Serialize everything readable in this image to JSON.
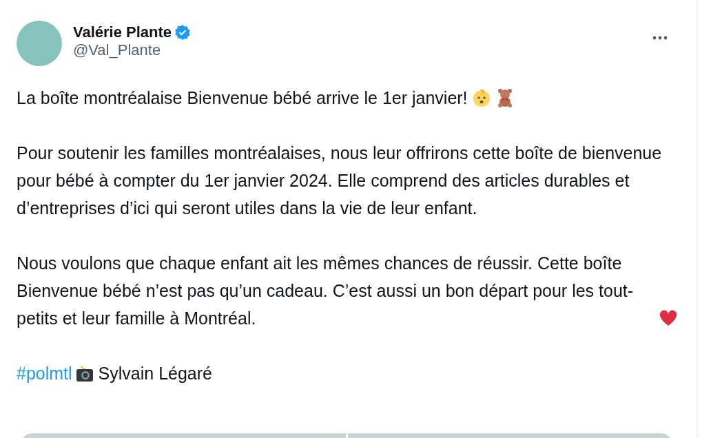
{
  "author": {
    "name": "Valérie Plante",
    "verified": true,
    "handle": "@Val_Plante"
  },
  "paragraphs": [
    "La boîte montréalaise Bienvenue bébé arrive le 1er janvier!",
    "Pour soutenir les familles montréalaises, nous leur offrirons cette boîte de bienvenue pour bébé à compter du 1er janvier 2024. Elle comprend des articles durables et d’entreprises d’ici qui seront utiles dans la vie de leur enfant.",
    "Nous voulons que chaque enfant ait les mêmes chances de réussir. Cette boîte Bienvenue bébé n’est pas qu’un cadeau. C’est aussi un bon départ pour les tout-petits et leur famille à Montréal."
  ],
  "hashtag": "#polmtl",
  "credit": "Sylvain Légaré"
}
